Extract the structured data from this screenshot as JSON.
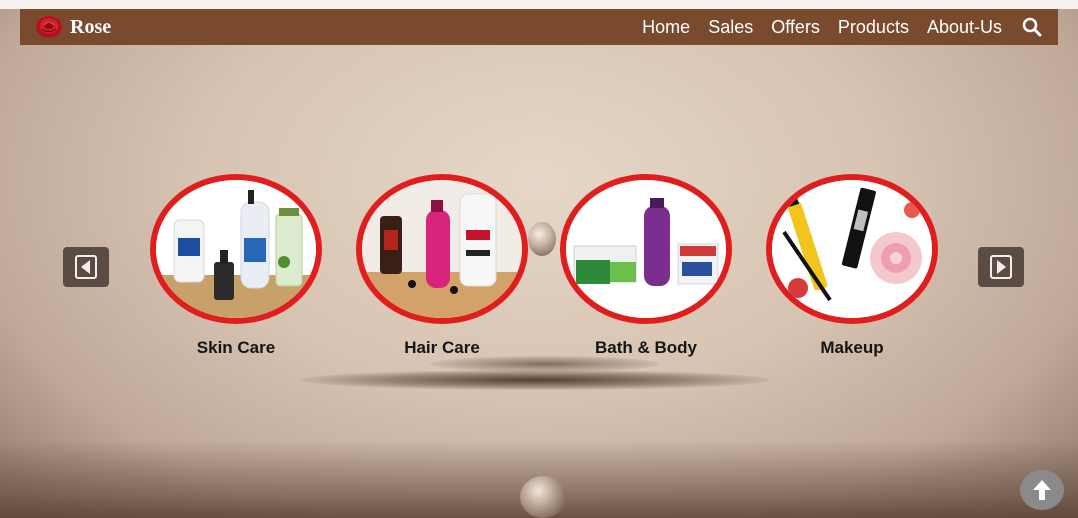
{
  "brand": {
    "name": "Rose",
    "logo_icon": "rose-flower-icon"
  },
  "nav": {
    "links": [
      "Home",
      "Sales",
      "Offers",
      "Products",
      "About-Us"
    ],
    "search_icon": "search-icon"
  },
  "carousel": {
    "prev_icon": "triangle-left-icon",
    "next_icon": "triangle-right-icon",
    "categories": [
      {
        "label": "Skin Care",
        "image": "skin-care-products-image"
      },
      {
        "label": "Hair Care",
        "image": "hair-care-products-image"
      },
      {
        "label": "Bath & Body",
        "image": "bath-body-products-image"
      },
      {
        "label": "Makeup",
        "image": "makeup-products-image"
      }
    ]
  },
  "scroll_top_icon": "arrow-up-icon",
  "colors": {
    "navbar": "#7a4a2e",
    "accent_ring": "#e01e1e",
    "arrow_button": "#5a4c44"
  }
}
